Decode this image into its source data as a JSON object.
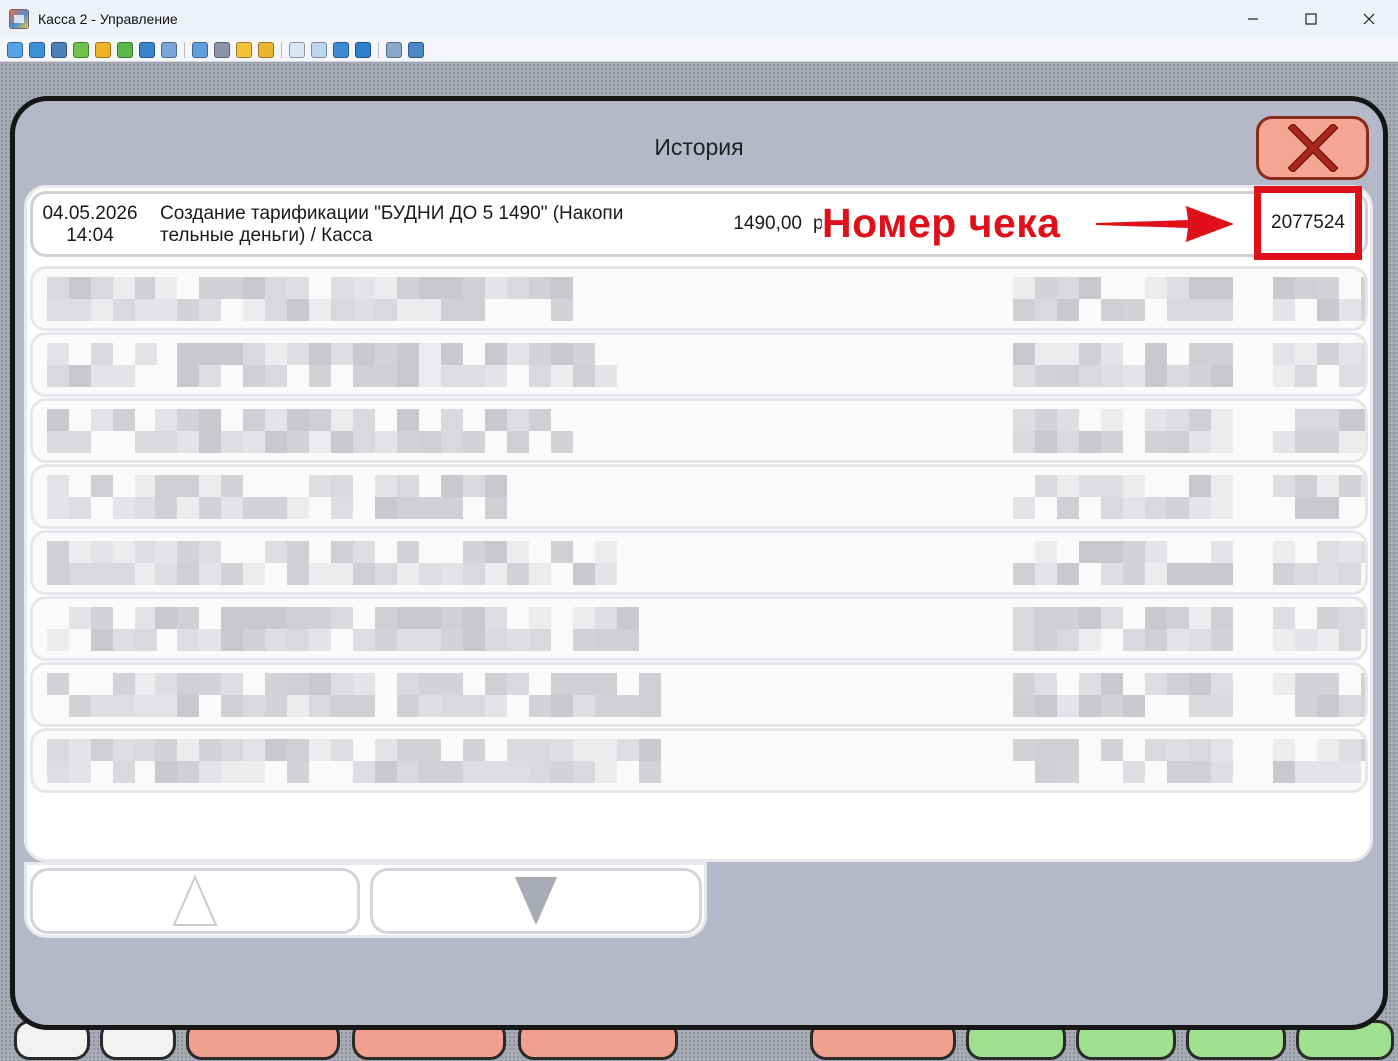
{
  "window": {
    "title": "Касса 2 - Управление",
    "controls": {
      "minimize": "—",
      "maximize": "☐",
      "close": "✕"
    }
  },
  "toolbar": {
    "icons": [
      "monitor-icon",
      "screen-icon",
      "console-icon",
      "sync-icon",
      "clock-icon",
      "chat-icon",
      "phone-icon",
      "message-icon",
      "upload-icon",
      "network-icon",
      "lock-icon",
      "lock2-icon",
      "window-icon",
      "fit-icon",
      "fullscreen-icon",
      "zoom-icon",
      "copy-icon",
      "tools-icon"
    ]
  },
  "dialog": {
    "title": "История",
    "close_icon": "close-x-icon"
  },
  "history": {
    "first_row": {
      "date": "04.05.2026",
      "time": "14:04",
      "description": "Создание тарификации \"БУДНИ ДО 5 1490\" (Накопи тельные деньги) / Касса",
      "amount": "1490,00",
      "currency": "р",
      "check_number": "2077524"
    },
    "blurred_rows_count": 8
  },
  "annotation": {
    "label": "Номер чека",
    "color": "#e0101a"
  },
  "pager": {
    "up_icon": "arrow-up-icon",
    "down_icon": "arrow-down-icon"
  },
  "colors": {
    "dialog_bg": "#b5b8c7",
    "close_bg": "#f5a594",
    "accent_red": "#e0101a"
  }
}
